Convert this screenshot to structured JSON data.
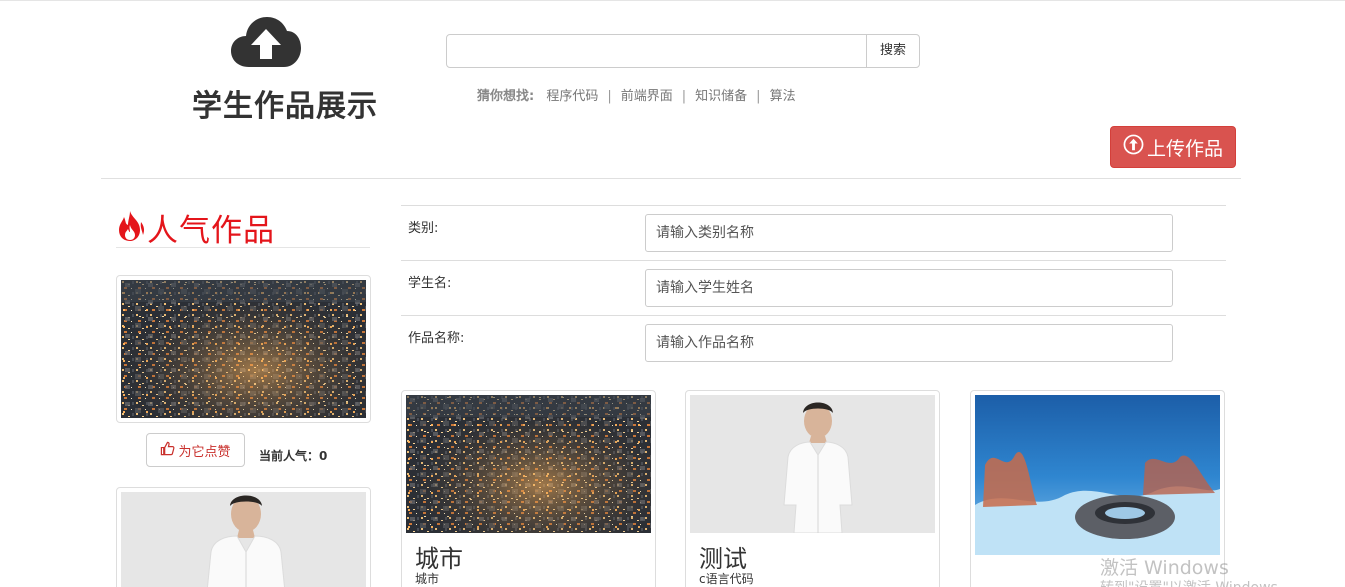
{
  "header": {
    "site_title": "学生作品展示",
    "logo_icon": "cloud-upload-icon",
    "search": {
      "value": "",
      "button_label": "搜索"
    },
    "guess": {
      "label": "猜你想找:",
      "links": [
        "程序代码",
        "前端界面",
        "知识储备",
        "算法"
      ],
      "separator": "|"
    },
    "upload_button": {
      "label": "上传作品",
      "icon": "circle-arrow-up-icon"
    }
  },
  "popular": {
    "heading": "人气作品",
    "icon": "fire-icon",
    "like_button": {
      "label": "为它点赞",
      "icon": "thumbs-up-icon"
    },
    "popularity_text": "当前人气：0",
    "items": [
      {
        "image": "city-night-aerial"
      },
      {
        "image": "man-white-shirt"
      }
    ]
  },
  "filters": [
    {
      "label": "类别:",
      "placeholder": "请输入类别名称"
    },
    {
      "label": "学生名:",
      "placeholder": "请输入学生姓名"
    },
    {
      "label": "作品名称:",
      "placeholder": "请输入作品名称"
    }
  ],
  "works": [
    {
      "title": "城市",
      "subtitle": "城市",
      "image": "city-night-aerial"
    },
    {
      "title": "测试",
      "subtitle": "c语言代码",
      "image": "man-white-shirt"
    },
    {
      "title": "",
      "subtitle": "",
      "image": "underwater-tire"
    }
  ],
  "watermark": {
    "line1": "激活 Windows",
    "line2": "转到\"设置\"以激活 Windows"
  },
  "colors": {
    "accent_red": "#e4151b",
    "upload_button": "#d9534f",
    "like_text": "#c9302c"
  }
}
